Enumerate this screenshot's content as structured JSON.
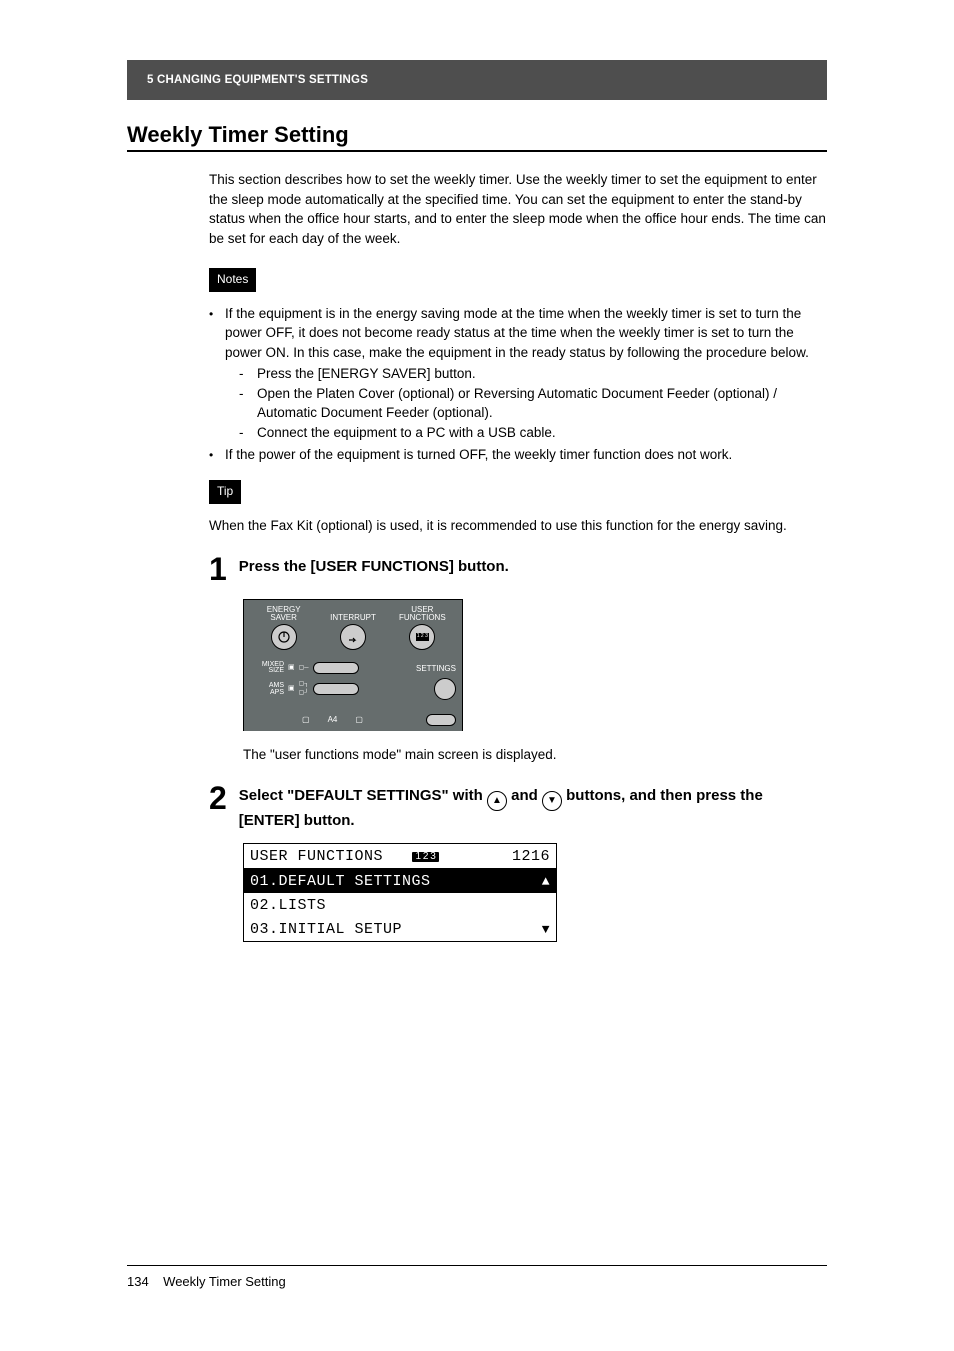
{
  "header": {
    "chapter": "5  CHANGING EQUIPMENT'S SETTINGS"
  },
  "heading": "Weekly Timer Setting",
  "intro": "This section describes how to set the weekly timer. Use the weekly timer to set the equipment to enter the sleep mode automatically at the specified time. You can set the equipment to enter the stand-by status when the office hour starts, and to enter the sleep mode when the office hour ends. The time can be set for each day of the week.",
  "labels": {
    "notes": "Notes",
    "tip": "Tip"
  },
  "notes": {
    "items": [
      {
        "text": "If the equipment is in the energy saving mode at the time when the weekly timer is set to turn the power OFF, it does not become ready status at the time when the weekly timer is set to turn the power ON. In this case, make the equipment in the ready status by following the procedure below.",
        "sub": [
          "Press the [ENERGY SAVER] button.",
          "Open the Platen Cover (optional) or Reversing Automatic Document Feeder (optional) / Automatic Document Feeder (optional).",
          "Connect the equipment to a PC with a USB cable."
        ]
      },
      {
        "text": "If the power of the equipment is turned OFF, the weekly timer function does not work.",
        "sub": []
      }
    ]
  },
  "tip": "When the Fax Kit (optional) is used, it is recommended to use this function for the energy saving.",
  "steps": [
    {
      "num": "1",
      "title": "Press the [USER FUNCTIONS] button.",
      "with_icons": false,
      "caption": "The \"user functions mode\" main screen is displayed."
    },
    {
      "num": "2",
      "title_parts": {
        "pre": "Select \"DEFAULT SETTINGS\" with ",
        "mid": " and ",
        "post": " buttons, and then press the [ENTER] button."
      },
      "with_icons": true
    }
  ],
  "panel": {
    "btns": [
      {
        "line1": "ENERGY",
        "line2": "SAVER"
      },
      {
        "line1": "",
        "line2": "INTERRUPT"
      },
      {
        "line1": "USER",
        "line2": "FUNCTIONS"
      }
    ],
    "mixed_size_label": "MIXED\nSIZE",
    "settings_label": "SETTINGS",
    "ams_label": "AMS",
    "aps_label": "APS",
    "a4_label": "A4"
  },
  "lcd": {
    "header": {
      "left": "USER FUNCTIONS",
      "badge": "1 2 3",
      "right": "1216"
    },
    "rows": [
      {
        "text": "01.DEFAULT SETTINGS",
        "hl": true,
        "arrow": "up"
      },
      {
        "text": "02.LISTS",
        "hl": false,
        "arrow": ""
      },
      {
        "text": "03.INITIAL SETUP",
        "hl": false,
        "arrow": "down"
      }
    ]
  },
  "footer": {
    "page_num": "134",
    "title": "Weekly Timer Setting"
  }
}
